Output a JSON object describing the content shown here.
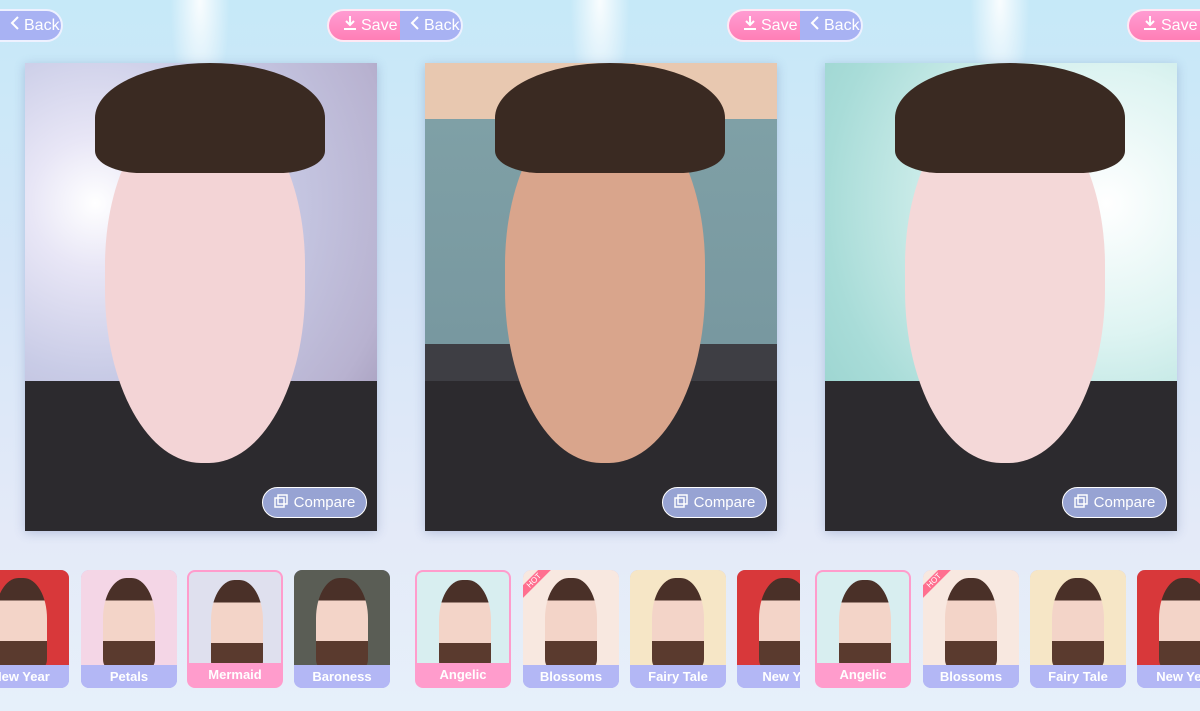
{
  "panels": [
    {
      "back_label": "Back",
      "save_label": "Save",
      "compare_label": "Compare",
      "photo_style": "mermaid-bokeh",
      "filters": [
        {
          "label": "New Year",
          "selected": false,
          "hot": false
        },
        {
          "label": "Petals",
          "selected": false,
          "hot": false
        },
        {
          "label": "Mermaid",
          "selected": true,
          "hot": false
        },
        {
          "label": "Baroness",
          "selected": false,
          "hot": false
        }
      ]
    },
    {
      "back_label": "Back",
      "save_label": "Save",
      "compare_label": "Compare",
      "photo_style": "original",
      "filters": [
        {
          "label": "Angelic",
          "selected": true,
          "hot": false
        },
        {
          "label": "Blossoms",
          "selected": false,
          "hot": true
        },
        {
          "label": "Fairy Tale",
          "selected": false,
          "hot": false
        },
        {
          "label": "New Ye",
          "selected": false,
          "hot": false
        }
      ]
    },
    {
      "back_label": "Back",
      "save_label": "Save",
      "compare_label": "Compare",
      "photo_style": "angelic-feathers",
      "filters": [
        {
          "label": "Angelic",
          "selected": true,
          "hot": false
        },
        {
          "label": "Blossoms",
          "selected": false,
          "hot": true
        },
        {
          "label": "Fairy Tale",
          "selected": false,
          "hot": false
        },
        {
          "label": "New Year",
          "selected": false,
          "hot": false
        }
      ]
    }
  ],
  "hot_badge": "HOT",
  "colors": {
    "save": "#ff85bb",
    "back": "#a8b2f3",
    "selected": "#ff9ccc",
    "label": "#b3b7f5"
  },
  "icons": {
    "back": "chevron-left-icon",
    "save": "download-icon",
    "compare": "compare-icon"
  }
}
